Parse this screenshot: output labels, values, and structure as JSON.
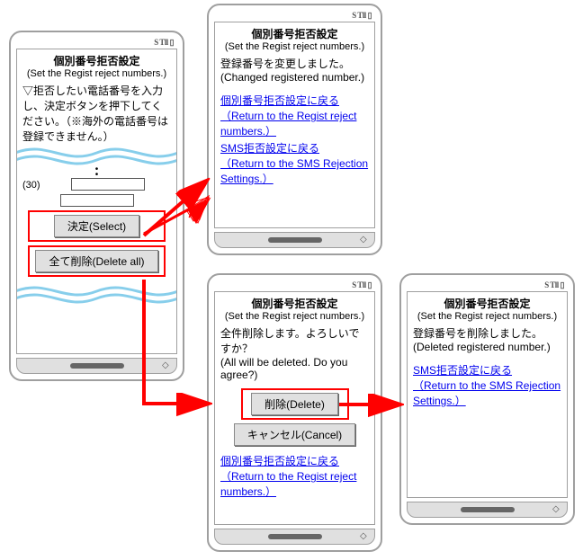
{
  "status": "S Tll ▯",
  "phone1": {
    "title": "個別番号拒否設定",
    "subtitle": "(Set the Regist reject numbers.)",
    "instruction": "▽拒否したい電話番号を入力し、決定ボタンを押下してください。（※海外の電話番号は登録できません。）",
    "entry_label": "(30)",
    "btn_select": "決定(Select)",
    "btn_delete_all": "全て削除(Delete all)"
  },
  "phone2": {
    "title": "個別番号拒否設定",
    "subtitle": "(Set the Regist reject numbers.)",
    "msg_jp": "登録番号を変更しました。",
    "msg_en": "(Changed registered number.)",
    "link1_jp": "個別番号拒否設定に戻る",
    "link1_en": "（Return to the Regist reject numbers.）",
    "link2_jp": "SMS拒否設定に戻る",
    "link2_en": "（Return to the SMS Rejection Settings.）"
  },
  "phone3": {
    "title": "個別番号拒否設定",
    "subtitle": "(Set the Regist reject numbers.)",
    "msg_jp": "全件削除します。よろしいですか？",
    "msg_en": "(All will be deleted. Do you agree?)",
    "btn_delete": "削除(Delete)",
    "btn_cancel": "キャンセル(Cancel)",
    "link1_jp": "個別番号拒否設定に戻る",
    "link1_en": "（Return to the Regist reject numbers.）"
  },
  "phone4": {
    "title": "個別番号拒否設定",
    "subtitle": "(Set the Regist reject numbers.)",
    "msg_jp": "登録番号を削除しました。",
    "msg_en": "(Deleted registered number.)",
    "link1_jp": "SMS拒否設定に戻る",
    "link1_en": "（Return to the SMS Rejection Settings.）"
  }
}
